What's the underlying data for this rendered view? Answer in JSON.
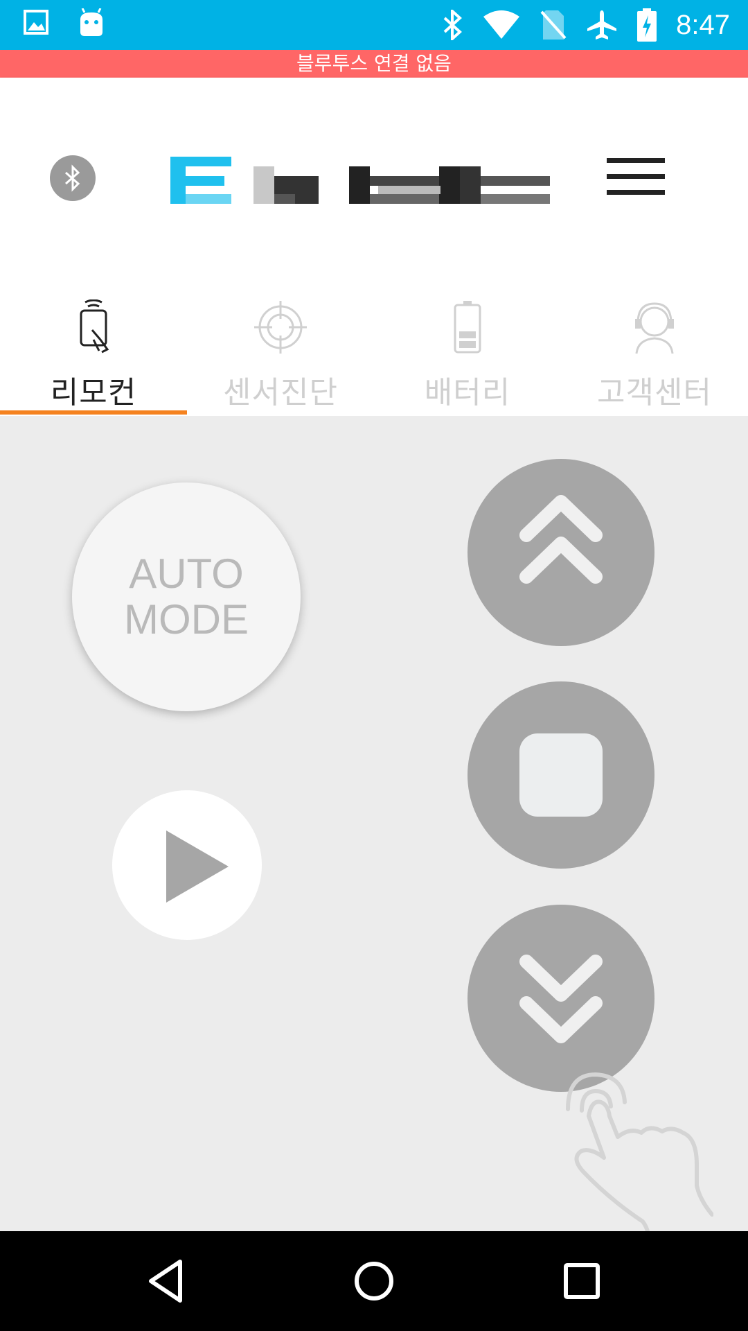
{
  "status_bar": {
    "time": "8:47",
    "left_icons": [
      "image-icon",
      "android-icon"
    ],
    "right_icons": [
      "bluetooth-icon",
      "wifi-icon",
      "no-sim-icon",
      "airplane-icon",
      "battery-charging-icon"
    ],
    "color": "#00b2e5"
  },
  "banner": {
    "text": "블루투스 연결 없음",
    "color": "#ff6666"
  },
  "header": {
    "bluetooth_icon": "bluetooth-icon",
    "menu_icon": "hamburger-menu-icon"
  },
  "tabs": [
    {
      "label": "리모컨",
      "icon": "remote-control-icon",
      "active": true
    },
    {
      "label": "센서진단",
      "icon": "crosshair-icon",
      "active": false
    },
    {
      "label": "배터리",
      "icon": "battery-icon",
      "active": false
    },
    {
      "label": "고객센터",
      "icon": "headset-agent-icon",
      "active": false
    }
  ],
  "controls": {
    "auto_mode": {
      "line1": "AUTO",
      "line2": "MODE"
    },
    "play_icon": "play-icon",
    "up_icon": "double-chevron-up-icon",
    "stop_icon": "stop-square-icon",
    "down_icon": "double-chevron-down-icon",
    "hint_icon": "tap-hand-icon"
  },
  "accent_color": "#f5821f",
  "navigation_bar": {
    "icons": [
      "back-icon",
      "home-icon",
      "recent-apps-icon"
    ]
  }
}
